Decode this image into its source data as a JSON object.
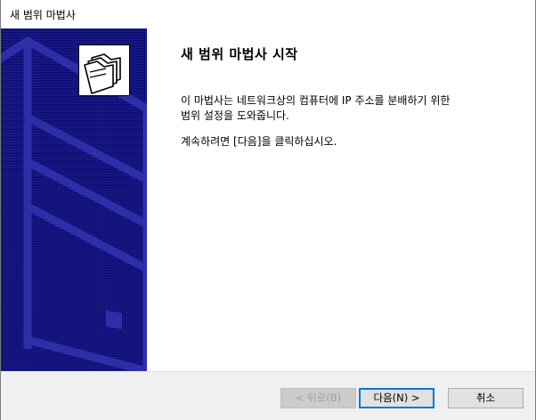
{
  "window": {
    "title": "새 범위 마법사"
  },
  "icons": {
    "banner_logo": "folder-stack-icon"
  },
  "colors": {
    "banner_bg": "#0c0c78",
    "accent": "#0078d7"
  },
  "content": {
    "heading": "새 범위 마법사 시작",
    "description_line1": "이 마법사는 네트워크상의 컴퓨터에 IP 주소를 분배하기 위한",
    "description_line2": "범위 설정을 도와줍니다.",
    "instruction": "계속하려면 [다음]을 클릭하십시오."
  },
  "buttons": {
    "back": "< 뒤로(B)",
    "next": "다음(N) >",
    "cancel": "취소"
  }
}
